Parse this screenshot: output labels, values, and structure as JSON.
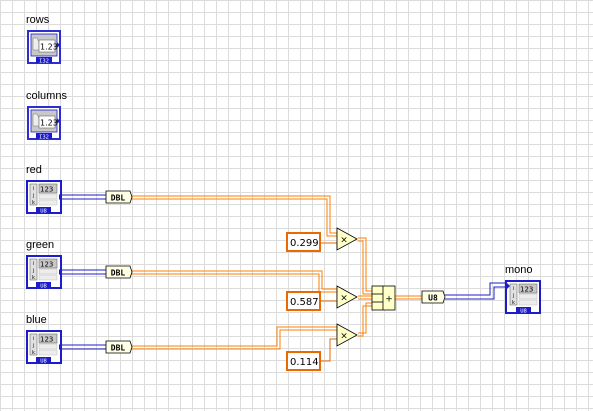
{
  "controls": {
    "rows": {
      "label": "rows",
      "display": "1.23",
      "type": "I32"
    },
    "columns": {
      "label": "columns",
      "display": "1.23",
      "type": "I32"
    },
    "red": {
      "label": "red",
      "display": "123",
      "indices": [
        "i",
        "j",
        "k"
      ],
      "type": "U8"
    },
    "green": {
      "label": "green",
      "display": "123",
      "indices": [
        "i",
        "j",
        "k"
      ],
      "type": "U8"
    },
    "blue": {
      "label": "blue",
      "display": "123",
      "indices": [
        "i",
        "j",
        "k"
      ],
      "type": "U8"
    }
  },
  "conversions": {
    "red_to_double": "DBL",
    "green_to_double": "DBL",
    "blue_to_double": "DBL",
    "sum_to_u8": "U8"
  },
  "constants": {
    "red_weight": "0.299",
    "green_weight": "0.587",
    "blue_weight": "0.114"
  },
  "operators": {
    "multiply_symbol": "×",
    "add_symbol": "+"
  },
  "indicator": {
    "label": "mono",
    "display": "123",
    "indices": [
      "i",
      "j",
      "k"
    ],
    "type": "U8"
  },
  "colors": {
    "grid": "#dcdcdc",
    "int_blue": "#1c1cc8",
    "double_orange": "#ff7f00",
    "constant_border": "#e86a00",
    "operator_fill": "#ffffc8"
  }
}
